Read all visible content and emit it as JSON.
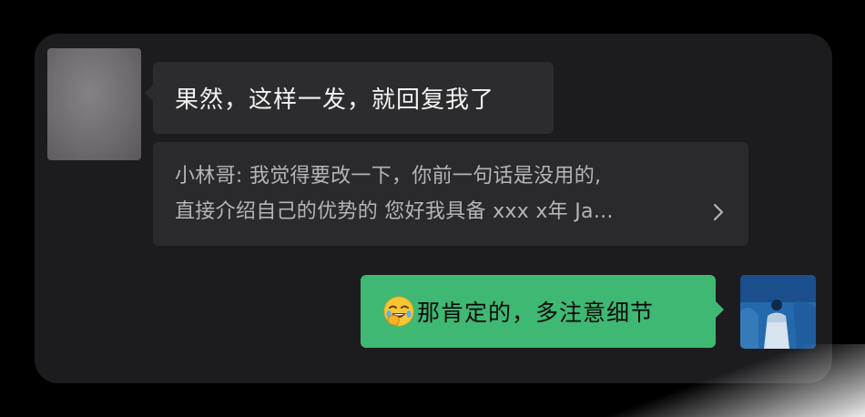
{
  "messages": {
    "incoming": {
      "text": "果然，这样一发，就回复我了",
      "quote": {
        "line1": "小林哥: 我觉得要改一下，你前一句话是没用的,",
        "line2": "直接介绍自己的优势的  您好我具备 xxx x年 Ja...",
        "expand_icon": "chevron-right-icon"
      }
    },
    "outgoing": {
      "emoji": "face-palm-laughing-emoji",
      "text": "那肯定的，多注意细节"
    }
  },
  "colors": {
    "background": "#000000",
    "card": "#1c1c1e",
    "incoming_bubble": "#2c2c2e",
    "quote_bubble": "#2a2a2c",
    "outgoing_bubble": "#3fb873"
  }
}
